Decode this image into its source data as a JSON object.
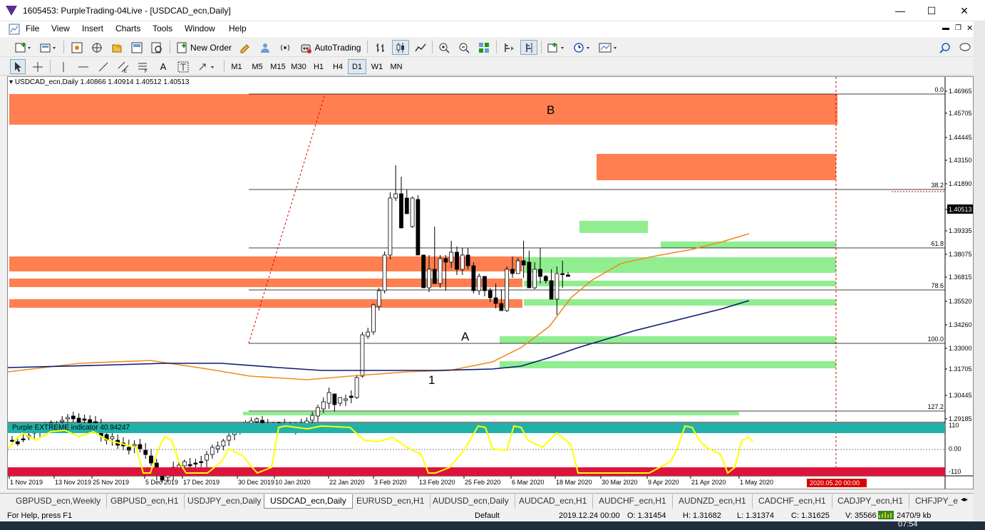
{
  "window": {
    "title": "1605453: PurpleTrading-04Live - [USDCAD_ecn,Daily]",
    "min": "—",
    "max": "☐",
    "close": "✕"
  },
  "menu": [
    "File",
    "View",
    "Insert",
    "Charts",
    "Tools",
    "Window",
    "Help"
  ],
  "toolbar": {
    "new_order": "New Order",
    "autotrading": "AutoTrading"
  },
  "timeframes": [
    "M1",
    "M5",
    "M15",
    "M30",
    "H1",
    "H4",
    "D1",
    "W1",
    "MN"
  ],
  "chart": {
    "header": "USDCAD_ecn,Daily  1.40866 1.40914 1.40512 1.40513",
    "current_price": "1.40513",
    "price_labels": [
      "1.46965",
      "1.45705",
      "1.44445",
      "1.43150",
      "1.41890",
      "1.40513",
      "1.39335",
      "1.38075",
      "1.36815",
      "1.35520",
      "1.34260",
      "1.33000",
      "1.31705",
      "1.30445",
      "1.29185"
    ],
    "fib_labels": [
      "0.0",
      "38.2",
      "61.8",
      "78.6",
      "100.0",
      "127.2"
    ],
    "annotations": [
      "B",
      "A",
      "1"
    ],
    "indicator_label": "Purple EXTREME indicator 40.94247",
    "indicator_levels": [
      "110",
      "0.00",
      "-110"
    ],
    "date_labels": [
      "1 Nov 2019",
      "13 Nov 2019",
      "25 Nov 2019",
      "5 Dec 2019",
      "17 Dec 2019",
      "30 Dec 2019",
      "10 Jan 2020",
      "22 Jan 2020",
      "3 Feb 2020",
      "13 Feb 2020",
      "25 Feb 2020",
      "6 Mar 2020",
      "18 Mar 2020",
      "30 Mar 2020",
      "9 Apr 2020",
      "21 Apr 2020",
      "1 May 2020"
    ],
    "future_date": "2020.05.20 00:00",
    "colors": {
      "supply": "#ff7f50",
      "demand": "#90ee90",
      "ma_fast": "#f08c1e",
      "ma_slow": "#0b1a6e",
      "indicator": "#ffff00",
      "ind_top": "#20b2aa",
      "ind_bottom": "#dc143c"
    }
  },
  "tabs": [
    "GBPUSD_ecn,Weekly",
    "GBPUSD_ecn,H1",
    "USDJPY_ecn,Daily",
    "USDCAD_ecn,Daily",
    "EURUSD_ecn,H1",
    "AUDUSD_ecn,Daily",
    "AUDCAD_ecn,H1",
    "AUDCHF_ecn,H1",
    "AUDNZD_ecn,H1",
    "CADCHF_ecn,H1",
    "CADJPY_ecn,H1",
    "CHFJPY_e"
  ],
  "active_tab": "USDCAD_ecn,Daily",
  "status": {
    "help": "For Help, press F1",
    "profile": "Default",
    "datetime": "2019.12.24 00:00",
    "open": "O: 1.31454",
    "high": "H: 1.31682",
    "low": "L: 1.31374",
    "close": "C: 1.31625",
    "volume": "V: 35566",
    "traffic": "2470/9 kb"
  },
  "taskbar": {
    "time": "07:54"
  }
}
